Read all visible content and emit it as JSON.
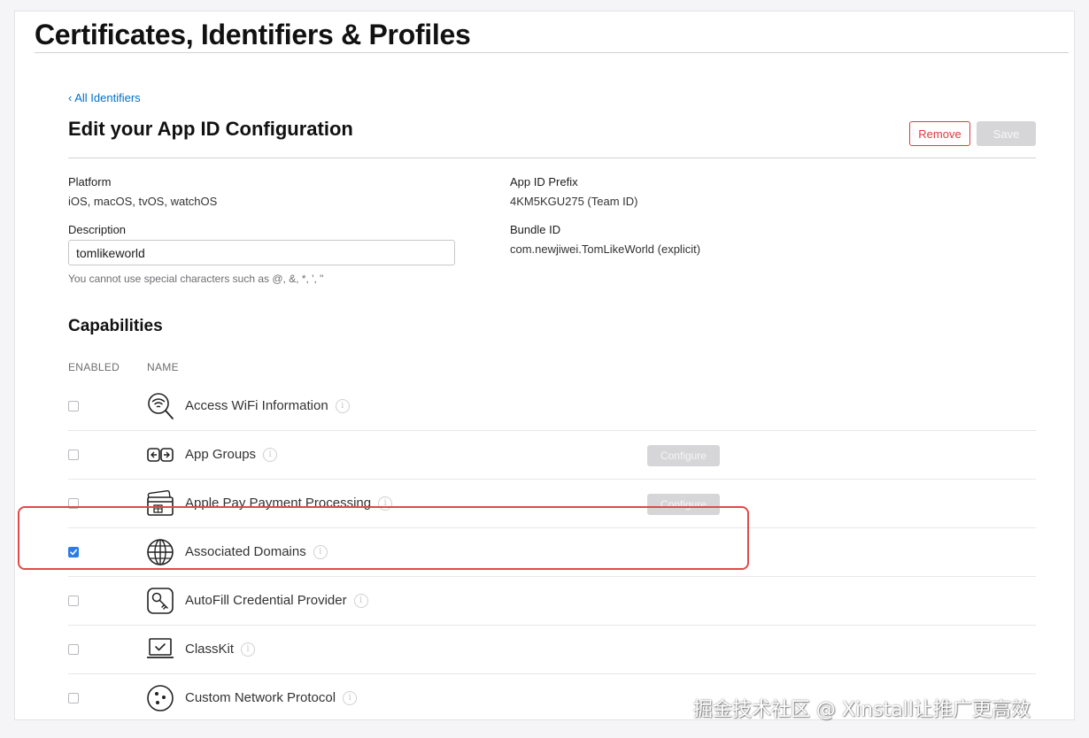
{
  "header": {
    "title": "Certificates, Identifiers & Profiles"
  },
  "nav": {
    "back_link": "‹ All Identifiers"
  },
  "section": {
    "title": "Edit your App ID Configuration",
    "remove_label": "Remove",
    "save_label": "Save"
  },
  "details": {
    "platform_label": "Platform",
    "platform_value": "iOS, macOS, tvOS, watchOS",
    "prefix_label": "App ID Prefix",
    "prefix_value": "4KM5KGU275 (Team ID)",
    "description_label": "Description",
    "description_value": "tomlikeworld",
    "description_help": "You cannot use special characters such as @, &, *, ', \"",
    "bundle_label": "Bundle ID",
    "bundle_value": "com.newjiwei.TomLikeWorld (explicit)"
  },
  "capabilities": {
    "title": "Capabilities",
    "col_enabled": "ENABLED",
    "col_name": "NAME",
    "configure_label": "Configure",
    "info_glyph": "i",
    "rows": [
      {
        "name": "Access WiFi Information",
        "icon": "wifi-search-icon",
        "enabled": false,
        "configure": false
      },
      {
        "name": "App Groups",
        "icon": "app-groups-icon",
        "enabled": false,
        "configure": true
      },
      {
        "name": "Apple Pay Payment Processing",
        "icon": "wallet-card-icon",
        "enabled": false,
        "configure": true
      },
      {
        "name": "Associated Domains",
        "icon": "globe-icon",
        "enabled": true,
        "configure": false
      },
      {
        "name": "AutoFill Credential Provider",
        "icon": "key-icon",
        "enabled": false,
        "configure": false
      },
      {
        "name": "ClassKit",
        "icon": "classkit-icon",
        "enabled": false,
        "configure": false
      },
      {
        "name": "Custom Network Protocol",
        "icon": "network-dots-icon",
        "enabled": false,
        "configure": false
      }
    ]
  },
  "colors": {
    "accent": "#0070c9",
    "danger": "#e0393e",
    "checked": "#2b7be8",
    "highlight": "#e14a4a"
  },
  "watermark": "掘金技术社区 @ Xinstall让推广更高效"
}
